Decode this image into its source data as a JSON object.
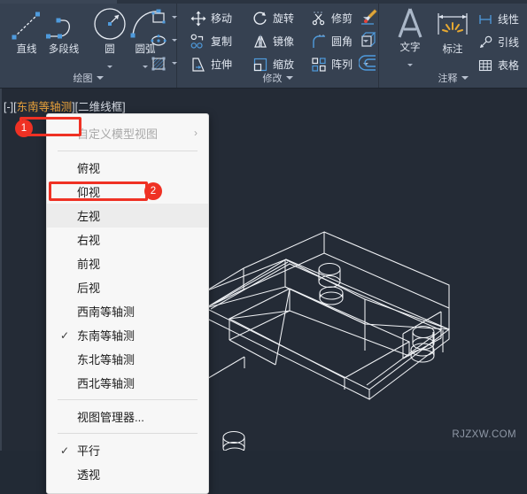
{
  "ribbon": {
    "panels": [
      {
        "id": "draw",
        "title": "绘图",
        "big_tools": [
          {
            "name": "line",
            "label": "直线",
            "icon": "line-icon"
          },
          {
            "name": "polyline",
            "label": "多段线",
            "icon": "polyline-icon"
          },
          {
            "name": "circle",
            "label": "圆",
            "icon": "circle-icon",
            "has_dropdown": true
          },
          {
            "name": "arc",
            "label": "圆弧",
            "icon": "arc-icon",
            "has_dropdown": true
          }
        ],
        "mini_tools": [
          {
            "name": "rectangle",
            "icon": "rectangle-icon"
          },
          {
            "name": "ellipse",
            "icon": "ellipse-icon"
          },
          {
            "name": "hatch",
            "icon": "hatch-icon"
          }
        ]
      },
      {
        "id": "modify",
        "title": "修改",
        "items": [
          {
            "name": "move",
            "label": "移动",
            "icon": "move-icon"
          },
          {
            "name": "rotate",
            "label": "旋转",
            "icon": "rotate-icon"
          },
          {
            "name": "trim",
            "label": "修剪",
            "icon": "trim-icon",
            "has_dropdown": true
          },
          {
            "name": "copy",
            "label": "复制",
            "icon": "copy-icon"
          },
          {
            "name": "mirror",
            "label": "镜像",
            "icon": "mirror-icon"
          },
          {
            "name": "fillet",
            "label": "圆角",
            "icon": "fillet-icon",
            "has_dropdown": true
          },
          {
            "name": "stretch",
            "label": "拉伸",
            "icon": "stretch-icon"
          },
          {
            "name": "scale",
            "label": "缩放",
            "icon": "scale-icon"
          },
          {
            "name": "array",
            "label": "阵列",
            "icon": "array-icon",
            "has_dropdown": true
          }
        ],
        "extra_icons": [
          {
            "name": "match-properties",
            "icon": "brush-icon"
          },
          {
            "name": "extrude",
            "icon": "box-icon"
          },
          {
            "name": "offset",
            "icon": "offset-icon"
          }
        ]
      },
      {
        "id": "annotate",
        "title": "注释",
        "big_tools": [
          {
            "name": "text",
            "label": "文字",
            "icon": "text-a-icon",
            "has_dropdown": true
          },
          {
            "name": "dimension",
            "label": "标注",
            "icon": "dimension-icon"
          }
        ],
        "items": [
          {
            "name": "linear-dimension",
            "label": "线性",
            "icon": "linear-dim-icon",
            "has_dropdown": true
          },
          {
            "name": "leader",
            "label": "引线",
            "icon": "leader-icon",
            "has_dropdown": true
          },
          {
            "name": "table",
            "label": "表格",
            "icon": "table-icon"
          }
        ]
      }
    ]
  },
  "canvas": {
    "viewport_label": {
      "prefix": "[-]",
      "open1": "[",
      "view_name": "东南等轴测",
      "close1": "]",
      "visual_style": "[二维线框]"
    },
    "watermark": "RJZXW.COM",
    "drawing_name": "isometric-wireframe-plate"
  },
  "menu": {
    "items": [
      {
        "label": "自定义模型视图",
        "name": "custom-model-view",
        "dim": true,
        "submenu": true,
        "arrow": "›"
      },
      {
        "type": "separator"
      },
      {
        "label": "俯视",
        "name": "top-view"
      },
      {
        "label": "仰视",
        "name": "bottom-view"
      },
      {
        "label": "左视",
        "name": "left-view",
        "highlighted": true
      },
      {
        "label": "右视",
        "name": "right-view"
      },
      {
        "label": "前视",
        "name": "front-view"
      },
      {
        "label": "后视",
        "name": "back-view"
      },
      {
        "label": "西南等轴测",
        "name": "sw-isometric-view"
      },
      {
        "label": "东南等轴测",
        "name": "se-isometric-view",
        "checked": true
      },
      {
        "label": "东北等轴测",
        "name": "ne-isometric-view"
      },
      {
        "label": "西北等轴测",
        "name": "nw-isometric-view"
      },
      {
        "type": "separator"
      },
      {
        "label": "视图管理器...",
        "name": "view-manager"
      },
      {
        "type": "separator"
      },
      {
        "label": "平行",
        "name": "parallel-projection",
        "checked": true
      },
      {
        "label": "透视",
        "name": "perspective-projection"
      }
    ],
    "check_glyph": "✓"
  },
  "annotations": {
    "badge1": "1",
    "badge2": "2",
    "accent_color": "#ef3124"
  },
  "colors": {
    "ribbon_bg": "#364151",
    "canvas_bg": "#242b36",
    "accent_blue": "#5b9bd5",
    "menu_bg": "#f7f7f7",
    "highlight_orange": "#e8a13a"
  }
}
